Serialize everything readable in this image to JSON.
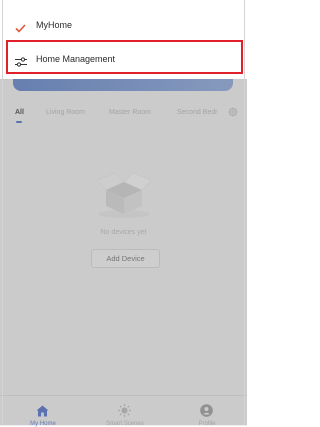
{
  "menu": {
    "items": [
      {
        "label": "MyHome",
        "icon": "checkmark-icon",
        "selected": true
      },
      {
        "label": "Home Management",
        "icon": "sliders-icon",
        "selected": false
      }
    ],
    "highlighted_item": "Home Management",
    "highlight_color": "#e0202a",
    "check_color": "#e0573a"
  },
  "rooms": {
    "tabs": [
      "All",
      "Living Room",
      "Master Room",
      "Second Bedr"
    ],
    "active_tab": "All",
    "settings_icon": "gear-icon"
  },
  "empty_state": {
    "icon": "empty-box-icon",
    "message": "No devices yet",
    "add_button": "Add Device"
  },
  "bottom_nav": {
    "items": [
      {
        "label": "My Home",
        "icon": "home-icon",
        "active": true
      },
      {
        "label": "Smart Scenes",
        "icon": "sun-icon",
        "active": false
      },
      {
        "label": "Profile",
        "icon": "profile-icon",
        "active": false
      }
    ],
    "accent_color": "#4a6cc4"
  }
}
